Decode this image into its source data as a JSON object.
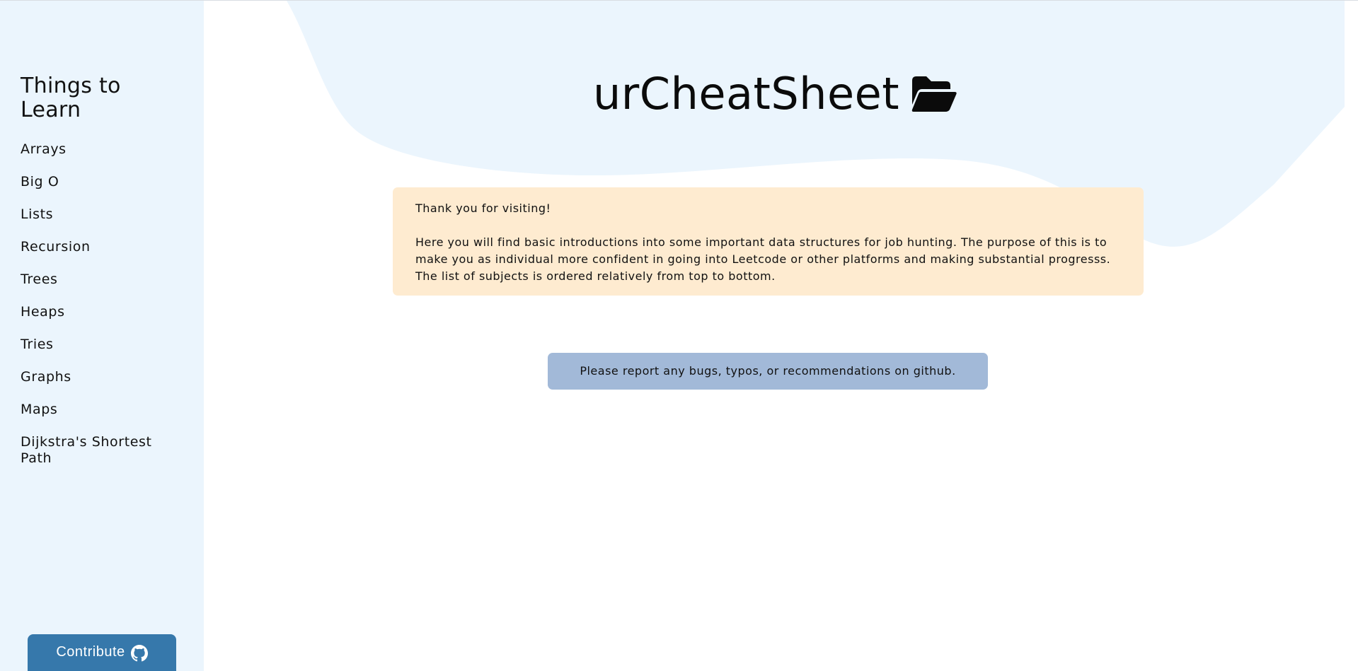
{
  "sidebar": {
    "title": "Things to Learn",
    "items": [
      {
        "label": "Arrays"
      },
      {
        "label": "Big O"
      },
      {
        "label": "Lists"
      },
      {
        "label": "Recursion"
      },
      {
        "label": "Trees"
      },
      {
        "label": "Heaps"
      },
      {
        "label": "Tries"
      },
      {
        "label": "Graphs"
      },
      {
        "label": "Maps"
      },
      {
        "label": "Dijkstra's Shortest Path"
      }
    ],
    "contribute_label": "Contribute",
    "contribute_icon": "github-icon"
  },
  "header": {
    "title": "urCheatSheet",
    "icon": "folder-open-icon"
  },
  "intro": {
    "greeting": "Thank you for visiting!",
    "body": "Here you will find basic introductions into some important data structures for job hunting. The purpose of this is to make you as individual more confident in going into Leetcode or other platforms and making substantial progresss. The list of subjects is ordered relatively from top to bottom."
  },
  "report": {
    "text": "Please report any bugs, typos, or recommendations on github."
  },
  "colors": {
    "sidebar_bg": "#ebf5fd",
    "blob": "#ebf5fd",
    "intro_bg": "#feebd0",
    "report_bg": "#a2b9d8",
    "contribute_bg": "#3678ab"
  }
}
